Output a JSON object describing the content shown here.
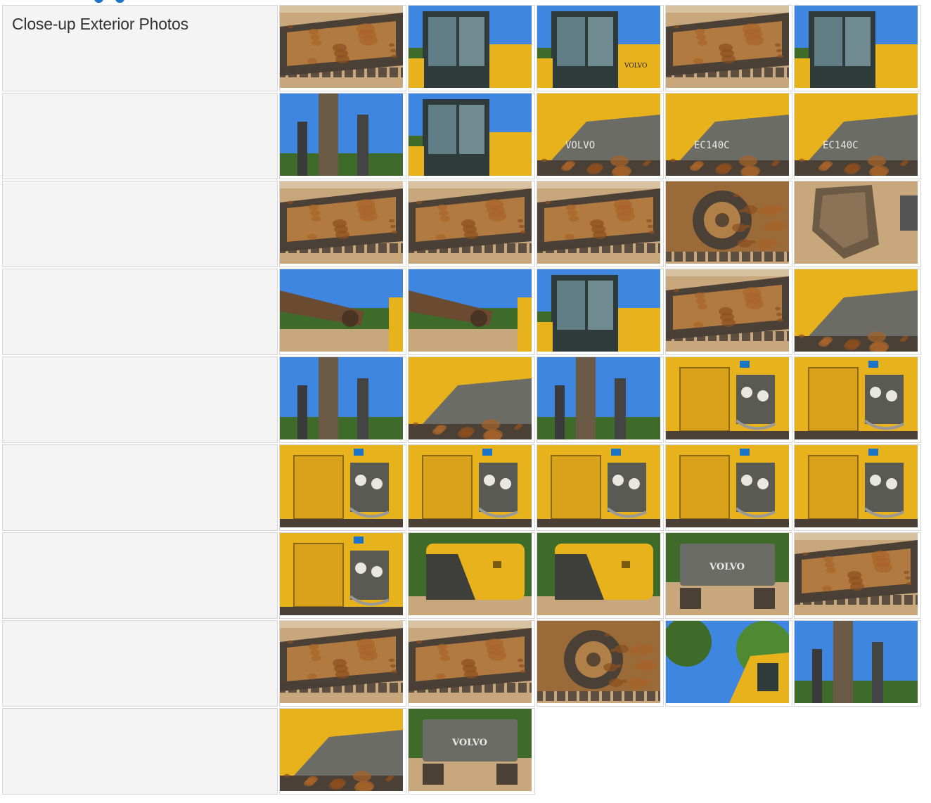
{
  "section": {
    "label": "Close-up Exterior Photos"
  },
  "colors": {
    "excavator_yellow": "#e8b21c",
    "sky_blue": "#3f86e0",
    "dirt": "#c9a77c",
    "rust": "#a8642a",
    "track_dark": "#4a4036",
    "tree_green": "#3e6b2a",
    "gray_panel": "#6c6c66",
    "accent_blue": "#1a75c9"
  },
  "photos": [
    [
      {
        "icon": "excavator-track-photo-icon",
        "scene": "track"
      },
      {
        "icon": "excavator-cab-photo-icon",
        "scene": "cab"
      },
      {
        "icon": "excavator-cab-side-photo-icon",
        "scene": "cab",
        "text": "VOLVO"
      },
      {
        "icon": "track-rust-photo-icon",
        "scene": "track"
      },
      {
        "icon": "excavator-cab-photo-icon",
        "scene": "cab"
      }
    ],
    [
      {
        "icon": "cab-roof-photo-icon",
        "scene": "sky"
      },
      {
        "icon": "excavator-cab-photo-icon",
        "scene": "cab"
      },
      {
        "icon": "volvo-body-panel-photo-icon",
        "scene": "panel",
        "text": "VOLVO"
      },
      {
        "icon": "model-decal-photo-icon",
        "scene": "panel",
        "text": "EC140C"
      },
      {
        "icon": "model-decal-photo-icon",
        "scene": "panel",
        "text": "EC140C"
      }
    ],
    [
      {
        "icon": "track-rust-photo-icon",
        "scene": "track"
      },
      {
        "icon": "track-rust-photo-icon",
        "scene": "track"
      },
      {
        "icon": "track-frame-photo-icon",
        "scene": "track"
      },
      {
        "icon": "drive-sprocket-photo-icon",
        "scene": "sprocket"
      },
      {
        "icon": "bucket-photo-icon",
        "scene": "bucket"
      }
    ],
    [
      {
        "icon": "boom-linkage-photo-icon",
        "scene": "arm"
      },
      {
        "icon": "boom-hoses-photo-icon",
        "scene": "arm"
      },
      {
        "icon": "cab-front-photo-icon",
        "scene": "cab"
      },
      {
        "icon": "undercarriage-photo-icon",
        "scene": "track"
      },
      {
        "icon": "hydraulic-cylinder-photo-icon",
        "scene": "panel"
      }
    ],
    [
      {
        "icon": "hydraulic-cylinder-photo-icon",
        "scene": "sky"
      },
      {
        "icon": "hydraulic-cylinder-photo-icon",
        "scene": "panel"
      },
      {
        "icon": "hydraulic-cylinder-photo-icon",
        "scene": "sky"
      },
      {
        "icon": "engine-door-open-photo-icon",
        "scene": "engine"
      },
      {
        "icon": "engine-door-open-photo-icon",
        "scene": "engine"
      }
    ],
    [
      {
        "icon": "engine-compartment-photo-icon",
        "scene": "engine"
      },
      {
        "icon": "fuel-filter-photo-icon",
        "scene": "engine"
      },
      {
        "icon": "engine-compartment-photo-icon",
        "scene": "engine"
      },
      {
        "icon": "engine-door-photo-icon",
        "scene": "engine"
      },
      {
        "icon": "fuel-filter-photo-icon",
        "scene": "engine"
      }
    ],
    [
      {
        "icon": "side-panel-photo-icon",
        "scene": "engine"
      },
      {
        "icon": "counterweight-photo-icon",
        "scene": "counterweight"
      },
      {
        "icon": "counterweight-photo-icon",
        "scene": "counterweight"
      },
      {
        "icon": "rear-counterweight-photo-icon",
        "scene": "rear",
        "text": "VOLVO"
      },
      {
        "icon": "track-rust-photo-icon",
        "scene": "track"
      }
    ],
    [
      {
        "icon": "track-rollers-photo-icon",
        "scene": "track"
      },
      {
        "icon": "track-rollers-photo-icon",
        "scene": "track"
      },
      {
        "icon": "drive-sprocket-photo-icon",
        "scene": "sprocket"
      },
      {
        "icon": "trees-cab-photo-icon",
        "scene": "trees"
      },
      {
        "icon": "boom-hoses-photo-icon",
        "scene": "sky"
      }
    ],
    [
      {
        "icon": "step-closeup-photo-icon",
        "scene": "panel"
      },
      {
        "icon": "rear-counterweight-photo-icon",
        "scene": "rear",
        "text": "VOLVO"
      }
    ]
  ]
}
